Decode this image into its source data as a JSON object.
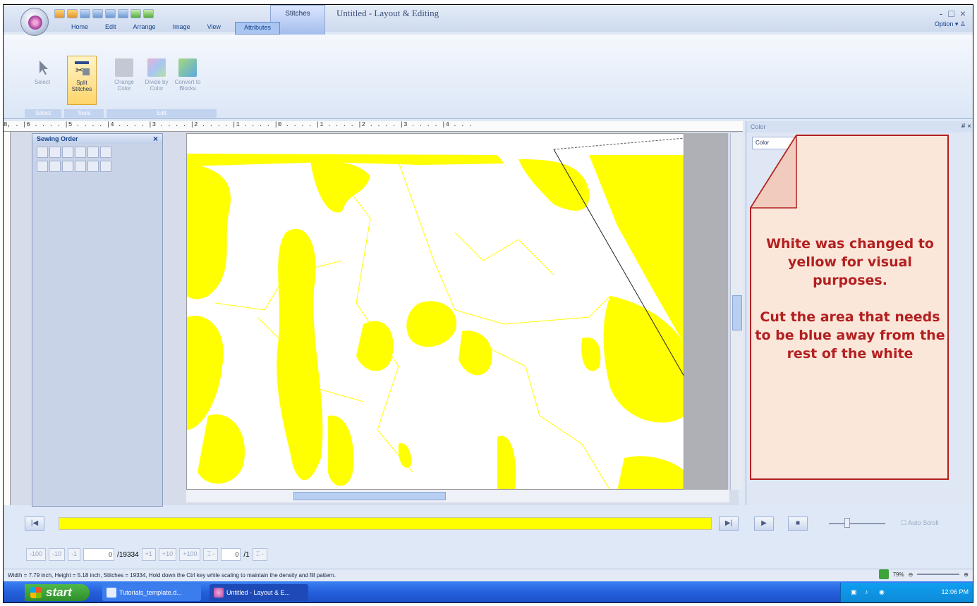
{
  "app": {
    "title": "Untitled - Layout & Editing",
    "context_tab": "Stitches",
    "option_label": "Option",
    "window_controls": [
      "-",
      "□",
      "×"
    ]
  },
  "tabs": [
    "Home",
    "Edit",
    "Arrange",
    "Image",
    "View",
    "Attributes"
  ],
  "ribbon": {
    "select": "Select",
    "split_stitches": "Split Stitches",
    "change_color": "Change Color",
    "divide_by_color": "Divide by Color",
    "convert_to_blocks": "Convert to Blocks",
    "group_labels": [
      "Select",
      "Tools",
      "Edit"
    ]
  },
  "ruler": {
    "top": "8, . |6 . . . . |5 . . . . |4 . . . . |3 . . . . |2 . . . . |1 . . . . |0 . . . . |1 . . . . |2 . . . . |3 . . . . |4 . . ."
  },
  "sewing_order": {
    "title": "Sewing Order",
    "close": "×"
  },
  "color_panel": {
    "title": "Color",
    "pin": "# ×",
    "tab": "Color"
  },
  "callout": {
    "text1": "White was changed to yellow for visual purposes.",
    "text2": "Cut the area that needs to be blue away from the rest of the  white",
    "fill": "#fbe6da",
    "border": "#b32020"
  },
  "playback": {
    "first": "|◀",
    "last": "▶|",
    "play": "▶",
    "stop": "■",
    "auto_scroll": "Auto Scroll",
    "progress_color": "#ffff00"
  },
  "stepper": {
    "minus100": "-100",
    "minus10": "-10",
    "minus1": "-1",
    "current": "0",
    "total": "/19334",
    "plus1": "+1",
    "plus10": "+10",
    "plus100": "+100",
    "block_current": "0",
    "block_total": "/1"
  },
  "status": {
    "text": "Width = 7.79 inch, Height = 5.18 inch, Stitches = 19334, Hold down the Ctrl key while scaling to maintain the density and fill pattern.",
    "zoom": "79%"
  },
  "taskbar": {
    "start": "start",
    "item1": "Tutorials_template.d...",
    "item2": "Untitled - Layout & E...",
    "clock": "12:06 PM"
  },
  "colors": {
    "stitch": "#ffff00",
    "ribbon_bg": "#dfe8f6",
    "taskbar": "#245edb"
  }
}
